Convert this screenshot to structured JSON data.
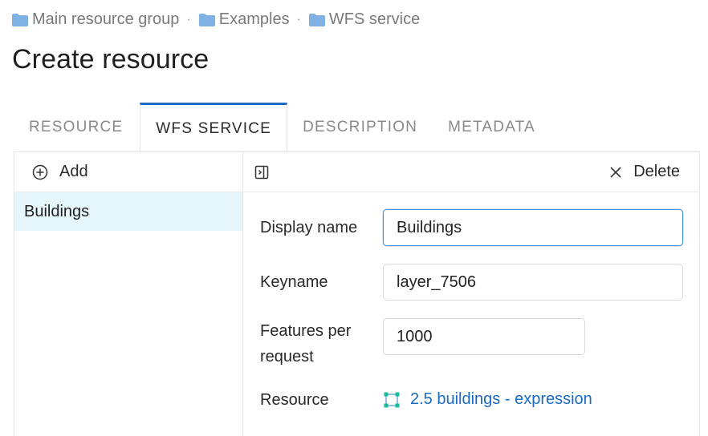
{
  "breadcrumb": {
    "items": [
      {
        "label": "Main resource group",
        "icon": "folder-icon"
      },
      {
        "label": "Examples",
        "icon": "folder-icon"
      },
      {
        "label": "WFS service",
        "icon": "folder-icon"
      }
    ],
    "separator": "·"
  },
  "page": {
    "title": "Create resource"
  },
  "tabs": [
    {
      "label": "RESOURCE",
      "active": false
    },
    {
      "label": "WFS SERVICE",
      "active": true
    },
    {
      "label": "DESCRIPTION",
      "active": false
    },
    {
      "label": "METADATA",
      "active": false
    }
  ],
  "list": {
    "add_label": "Add",
    "items": [
      {
        "label": "Buildings",
        "selected": true
      }
    ]
  },
  "editor": {
    "delete_label": "Delete",
    "fields": {
      "display_name": {
        "label": "Display name",
        "value": "Buildings"
      },
      "keyname": {
        "label": "Keyname",
        "value": "layer_7506"
      },
      "features_per_request": {
        "label_line1": "Features per",
        "label_line2": "request",
        "value": "1000"
      },
      "resource": {
        "label": "Resource",
        "value": "2.5 buildings - expression",
        "icon": "vector-layer-icon"
      }
    }
  },
  "colors": {
    "accent": "#1a6bc2",
    "folder": "#7fb1e3",
    "selected_bg": "#e6f6fd",
    "vector_icon": "#1abc9c"
  }
}
